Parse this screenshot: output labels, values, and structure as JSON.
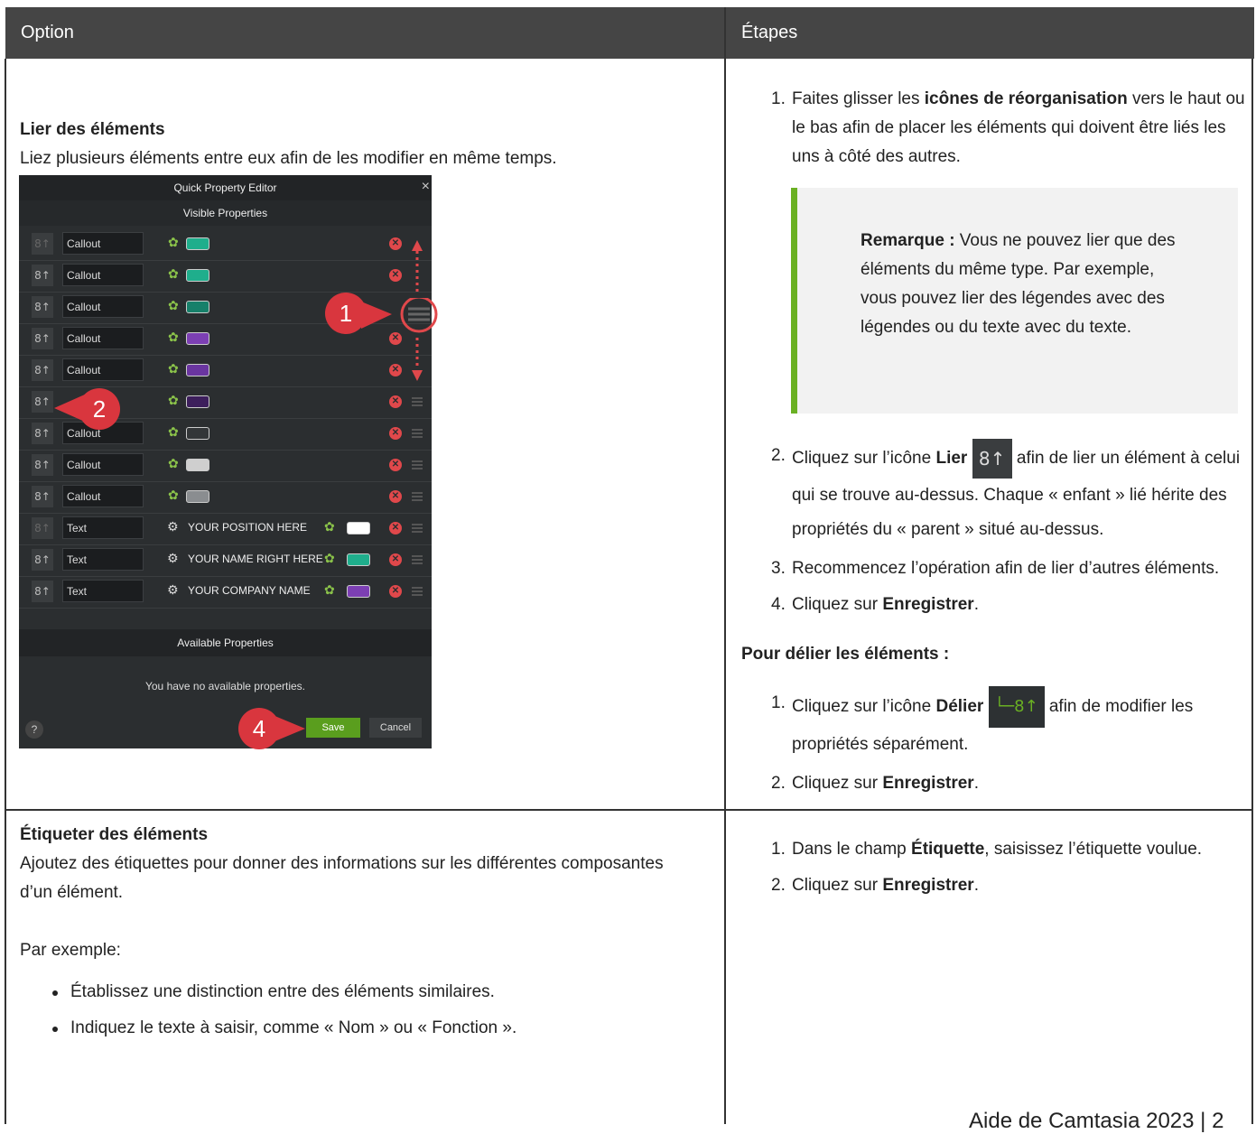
{
  "table": {
    "headers": [
      "Option",
      "Étapes"
    ],
    "row1": {
      "title": "Lier des éléments",
      "desc": "Liez plusieurs éléments entre eux afin de les modifier en même temps.",
      "steps": [
        {
          "n": "1.",
          "pre": "Faites glisser les ",
          "bold": "icônes de réorganisation",
          "post": " vers le haut ou le bas afin de placer les éléments qui doivent être liés les uns à côté des autres."
        },
        {
          "n": "2.",
          "pre": "Cliquez sur l’icône ",
          "bold": "Lier",
          "post": " afin de lier un élément à celui qui se trouve au-dessus. Chaque « enfant » lié hérite des propriétés du « parent » situé au-dessus."
        },
        {
          "n": "3.",
          "pre": "Recommencez l’opération afin de lier d’autres éléments.",
          "bold": "",
          "post": ""
        },
        {
          "n": "4.",
          "pre": "Cliquez sur ",
          "bold": "Enregistrer",
          "post": "."
        }
      ],
      "note": {
        "label": "Remarque :",
        "text": " Vous ne pouvez lier que des éléments du même type. Par exemple, vous pouvez lier des légendes avec des légendes ou du texte avec du texte."
      },
      "unlink_heading": "Pour délier les éléments :",
      "unlink_steps": [
        {
          "n": "1.",
          "pre": "Cliquez sur l’icône ",
          "bold": "Délier",
          "post": " afin de modifier les propriétés séparément."
        },
        {
          "n": "2.",
          "pre": "Cliquez sur ",
          "bold": "Enregistrer",
          "post": "."
        }
      ]
    },
    "row2": {
      "title": "Étiqueter des éléments",
      "desc": "Ajoutez des étiquettes pour donner des informations sur les différentes composantes d’un élément.",
      "example_label": "Par exemple:",
      "bullets": [
        "Établissez une distinction entre des éléments similaires.",
        "Indiquez le texte à saisir, comme « Nom » ou « Fonction »."
      ],
      "steps": [
        {
          "n": "1.",
          "pre": "Dans le champ ",
          "bold": "Étiquette",
          "post": ", saisissez l’étiquette voulue."
        },
        {
          "n": "2.",
          "pre": "Cliquez sur ",
          "bold": "Enregistrer",
          "post": "."
        }
      ]
    }
  },
  "editor": {
    "title": "Quick Property Editor",
    "visible_label": "Visible Properties",
    "close": "×",
    "rows": [
      {
        "name": "Callout",
        "color": "#1fae8c"
      },
      {
        "name": "Callout",
        "color": "#1fae8c"
      },
      {
        "name": "Callout",
        "color": "#17806a"
      },
      {
        "name": "Callout",
        "color": "#7c3fb3"
      },
      {
        "name": "Callout",
        "color": "#6a35a0"
      },
      {
        "name": "",
        "color": "#3d1f5c"
      },
      {
        "name": "Callout",
        "color": "#333638"
      },
      {
        "name": "Callout",
        "color": "#cfcfcf"
      },
      {
        "name": "Callout",
        "color": "#8a8d90"
      }
    ],
    "text_rows": [
      {
        "name": "Text",
        "prop": "YOUR POSITION HERE",
        "color": "#ffffff"
      },
      {
        "name": "Text",
        "prop": "YOUR NAME RIGHT HERE",
        "color": "#1fae8c"
      },
      {
        "name": "Text",
        "prop": "YOUR COMPANY NAME",
        "color": "#7c3fb3"
      }
    ],
    "available_label": "Available Properties",
    "no_props": "You have no available properties.",
    "help": "?",
    "save": "Save",
    "cancel": "Cancel",
    "callouts": [
      "1",
      "2",
      "4"
    ]
  },
  "footer": "Aide de Camtasia 2023 | 2"
}
